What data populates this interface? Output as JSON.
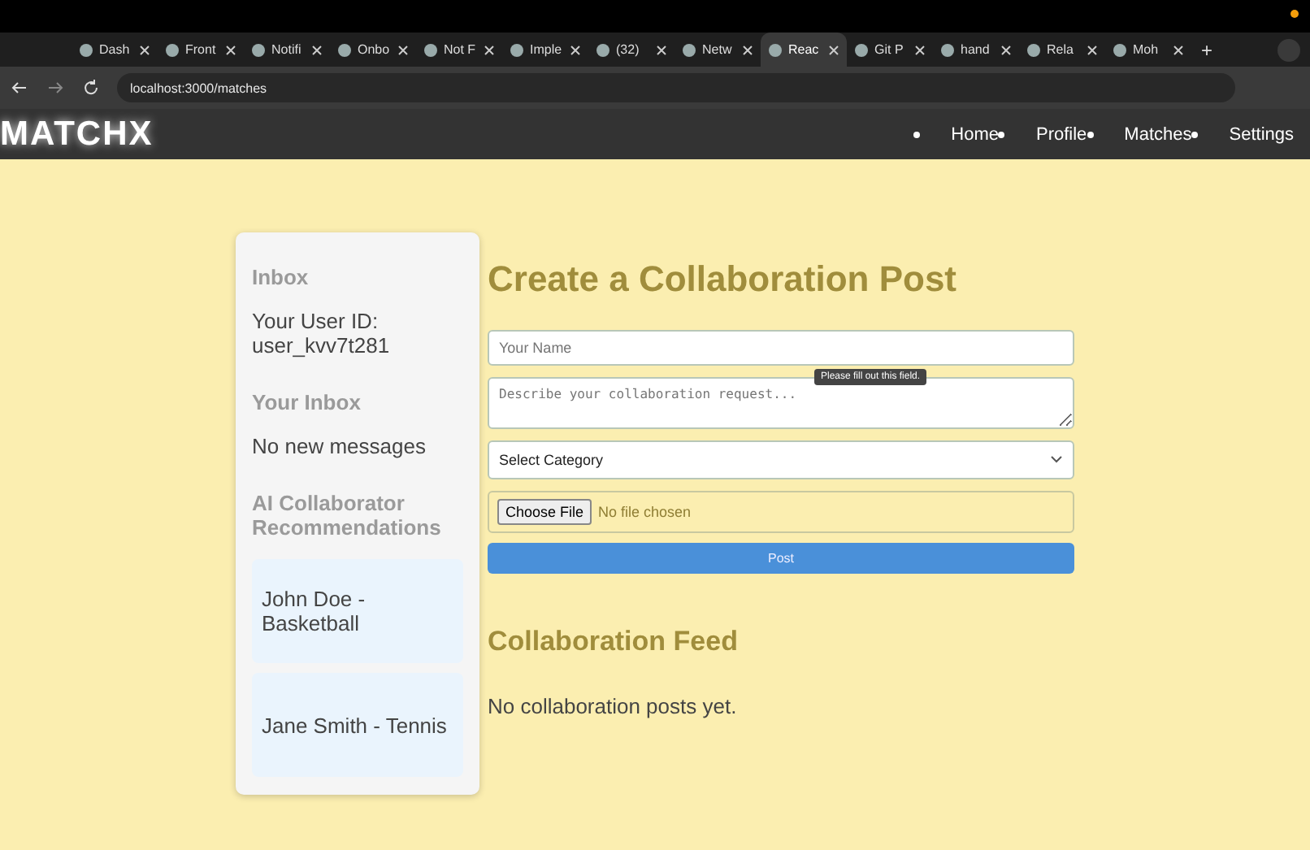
{
  "browser": {
    "tabs": [
      {
        "title": "Dash",
        "selected": false
      },
      {
        "title": "Front",
        "selected": false
      },
      {
        "title": "Notifi",
        "selected": false
      },
      {
        "title": "Onbo",
        "selected": false
      },
      {
        "title": "Not F",
        "selected": false
      },
      {
        "title": "Imple",
        "selected": false
      },
      {
        "title": "(32)",
        "selected": false
      },
      {
        "title": "Netw",
        "selected": false
      },
      {
        "title": "Reac",
        "selected": true
      },
      {
        "title": "Git P",
        "selected": false
      },
      {
        "title": "hand",
        "selected": false
      },
      {
        "title": "Rela",
        "selected": false
      },
      {
        "title": "Moh",
        "selected": false
      }
    ],
    "new_tab": "+",
    "address": "localhost:3000/matches"
  },
  "navbar": {
    "logo": "MATCHX",
    "leading_dot": true,
    "items": [
      {
        "label": "Home",
        "dot": true
      },
      {
        "label": "Profile",
        "dot": true
      },
      {
        "label": "Matches",
        "dot": true
      },
      {
        "label": "Settings",
        "dot": false
      }
    ]
  },
  "sidebar": {
    "title": "Inbox",
    "user_id": "Your User ID: user_kvv7t281",
    "inbox_title": "Your Inbox",
    "inbox_empty": "No new messages",
    "recommendations_title": "AI Collaborator Recommendations",
    "recommendations": [
      {
        "label": "John Doe - Basketball"
      },
      {
        "label": "Jane Smith - Tennis"
      }
    ]
  },
  "form": {
    "title": "Create a Collaboration Post",
    "name_placeholder": "Your Name",
    "request_placeholder": "Describe your collaboration request...",
    "tooltip": "Please fill out this field.",
    "category": "Select Category",
    "file_button": "Choose File",
    "file_status": "No file chosen",
    "submit": "Post"
  },
  "feed": {
    "title": "Collaboration Feed",
    "empty": "No collaboration posts yet."
  }
}
